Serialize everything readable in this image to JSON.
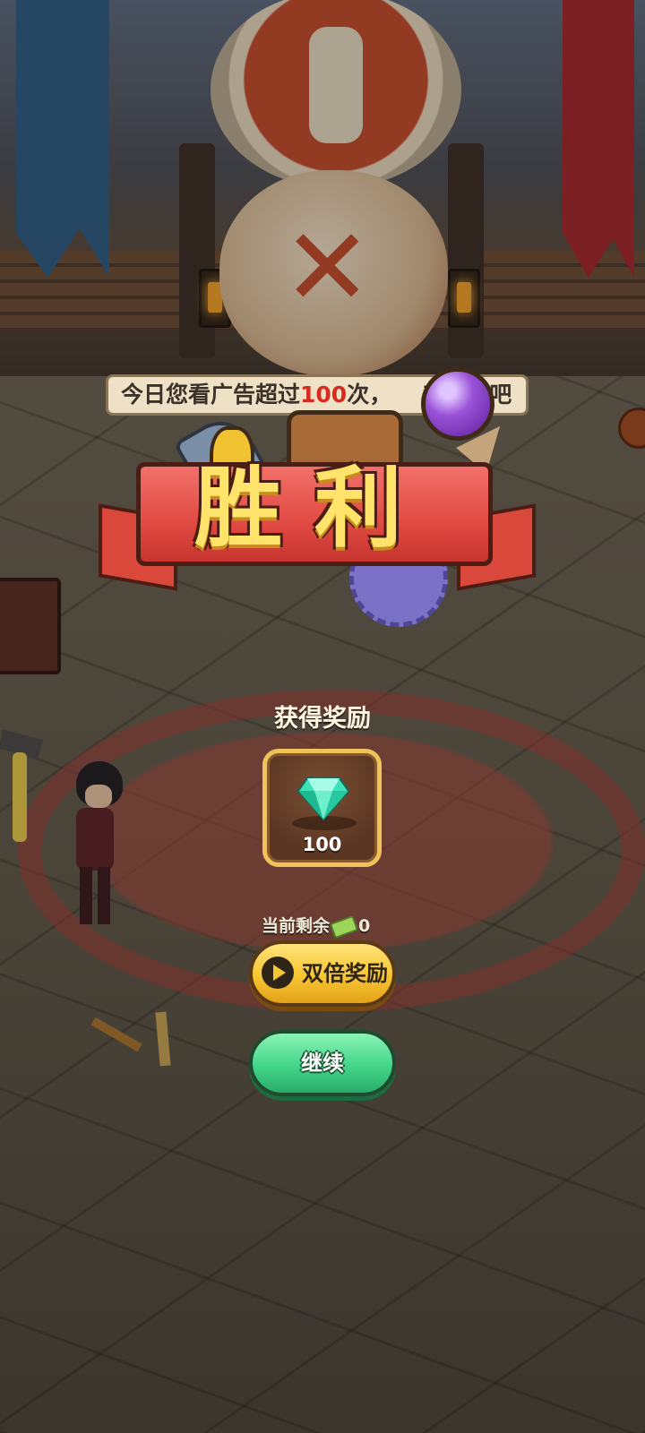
{
  "ticker": {
    "prefix": "今日您看广告超过",
    "count": "100",
    "suffix": "次，",
    "tail": "来试试吧"
  },
  "victory": {
    "title": "胜利"
  },
  "reward": {
    "heading": "获得奖励",
    "item_icon": "diamond-gem-icon",
    "item_count": "100"
  },
  "remaining": {
    "label": "当前剩余",
    "icon": "ticket-icon",
    "value": "0"
  },
  "buttons": {
    "double_reward": "双倍奖励",
    "continue": "继续"
  },
  "colors": {
    "double_button": "#f7c531",
    "continue_button": "#43d58a",
    "ribbon": "#e04a42",
    "title_text": "#ffe36a",
    "highlight": "#d92a1f"
  }
}
